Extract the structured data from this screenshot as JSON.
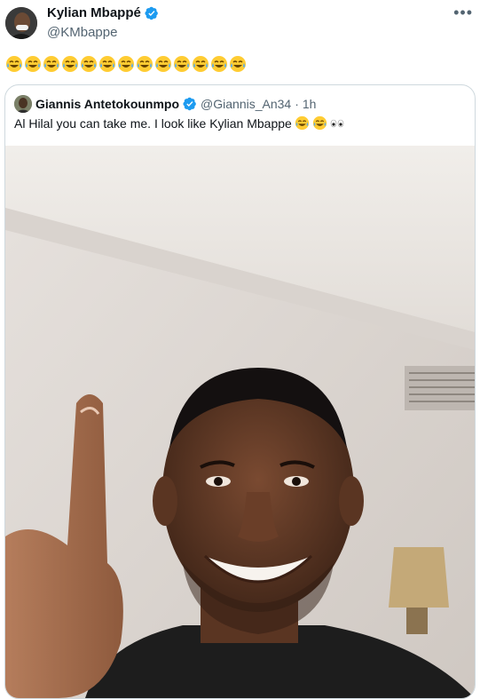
{
  "tweet": {
    "author_name": "Kylian Mbappé",
    "author_handle": "@KMbappe",
    "more_label": "•••",
    "emoji_icon": "face-with-tears-of-joy",
    "emoji_count": 13
  },
  "quote": {
    "author_name": "Giannis Antetokounmpo",
    "author_handle": "@Giannis_An34",
    "separator": "·",
    "time": "1h",
    "text": "Al Hilal you can take me. I look like Kylian Mbappe",
    "text_emojis": [
      "face-with-tears-of-joy",
      "face-with-tears-of-joy",
      "eyes"
    ]
  },
  "colors": {
    "verified": "#1d9bf0",
    "secondary_text": "#536471",
    "border": "#cfd9de"
  }
}
